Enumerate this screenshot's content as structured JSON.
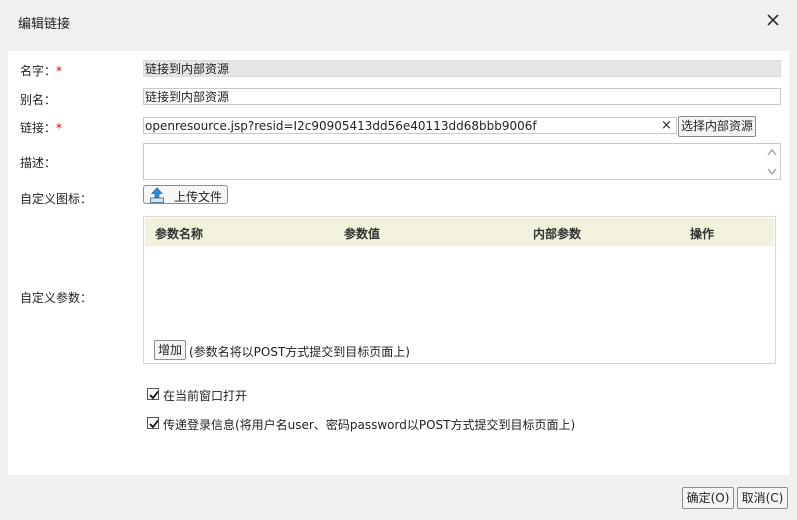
{
  "dialog": {
    "title": "编辑链接",
    "close_icon": "close-icon"
  },
  "form": {
    "name_label": "名字：",
    "alias_label": "别名：",
    "link_label": "链接：",
    "desc_label": "描述：",
    "icon_label": "自定义图标：",
    "params_label": "自定义参数：",
    "required_mark": "*",
    "name_value": "链接到内部资源",
    "alias_value": "链接到内部资源",
    "link_value": "openresource.jsp?resid=I2c90905413dd56e40113dd68bbb9006f",
    "clear_icon": "×",
    "select_resource_button": "选择内部资源",
    "desc_value": "",
    "upload_button": "上传文件"
  },
  "params_table": {
    "columns": [
      "参数名称",
      "参数值",
      "内部参数",
      "操作"
    ],
    "rows": [],
    "add_button": "增加",
    "note": "(参数名将以POST方式提交到目标页面上)"
  },
  "options": {
    "open_current_window": {
      "label": "在当前窗口打开",
      "checked": true
    },
    "pass_login_info": {
      "label": "传递登录信息(将用户名user、密码password以POST方式提交到目标页面上)",
      "checked": true
    }
  },
  "footer": {
    "ok_button": "确定(O)",
    "cancel_button": "取消(C)"
  }
}
